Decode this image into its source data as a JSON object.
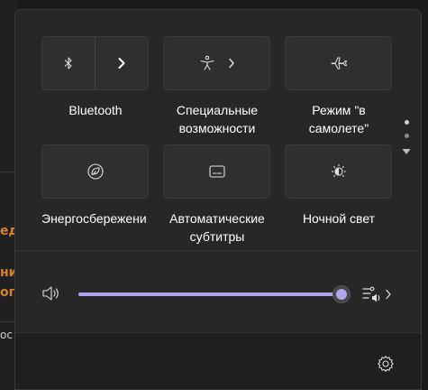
{
  "background_app": {
    "fragments": [
      "ед",
      "ни",
      "ого",
      "ос"
    ]
  },
  "quick_settings": {
    "tiles": [
      {
        "label": "Bluetooth",
        "icon": "bluetooth-icon",
        "has_chevron": true
      },
      {
        "label": "Специальные\nвозможности",
        "icon": "accessibility-icon",
        "has_chevron": true
      },
      {
        "label": "Режим \"в\nсамолете\"",
        "icon": "airplane-icon",
        "has_chevron": false
      },
      {
        "label": "Энергосбережени",
        "icon": "energy-saver-leaf-icon",
        "has_chevron": false
      },
      {
        "label": "Автоматические\nсубтитры",
        "icon": "live-captions-icon",
        "has_chevron": false
      },
      {
        "label": "Ночной свет",
        "icon": "night-light-icon",
        "has_chevron": false
      }
    ],
    "pager": {
      "pages": 2,
      "current": 1
    },
    "volume": {
      "level": 100,
      "speaker_icon": "speaker-icon",
      "output_icon": "sound-output-icon"
    },
    "footer": {
      "settings_icon": "gear-icon"
    }
  },
  "colors": {
    "accent": "#b4a3ee",
    "panel": "#272727",
    "tile": "#2f2f2f",
    "bg_app_text": "#d9822b"
  }
}
